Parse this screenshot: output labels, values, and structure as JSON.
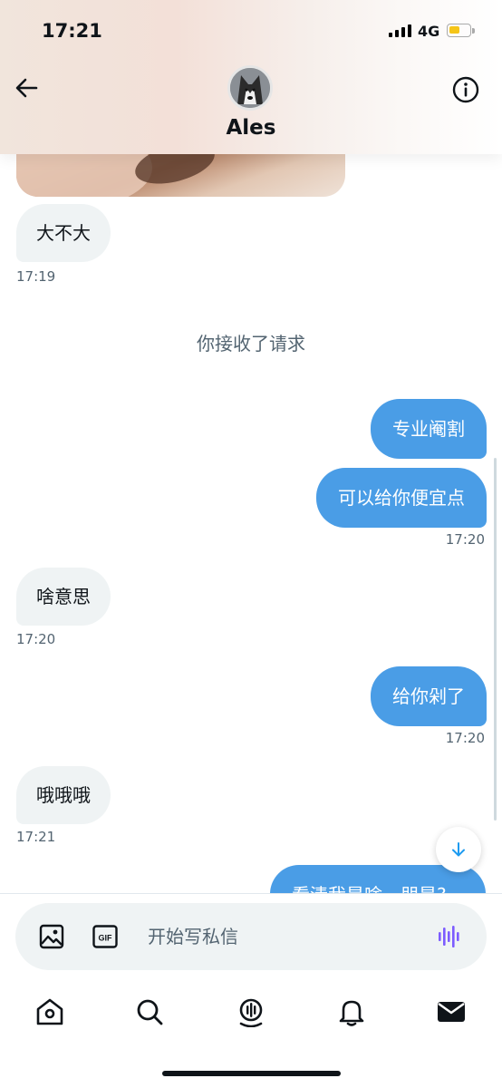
{
  "status_bar": {
    "time": "17:21",
    "network": "4G"
  },
  "header": {
    "contact_name": "Ales",
    "back_icon": "arrow-left-icon",
    "info_icon": "info-icon"
  },
  "messages": [
    {
      "direction": "in",
      "text": "大不大",
      "time": "17:19"
    },
    {
      "direction": "system",
      "text": "你接收了请求"
    },
    {
      "direction": "out",
      "text": "专业阉割"
    },
    {
      "direction": "out",
      "text": "可以给你便宜点",
      "time": "17:20"
    },
    {
      "direction": "in",
      "text": "啥意思",
      "time": "17:20"
    },
    {
      "direction": "out",
      "text": "给你剁了",
      "time": "17:20"
    },
    {
      "direction": "in",
      "text": "哦哦哦",
      "time": "17:21"
    },
    {
      "direction": "out",
      "text": "看清我是啥，朋是?"
    }
  ],
  "composer": {
    "placeholder": "开始写私信",
    "gif_label": "GIF"
  },
  "nav": {
    "items": [
      "home-icon",
      "search-icon",
      "spaces-icon",
      "notifications-icon",
      "messages-icon"
    ],
    "active": "messages-icon"
  },
  "colors": {
    "outgoing_bubble": "#4a9de6",
    "incoming_bubble": "#eff3f4",
    "accent_voice": "#7c5cff"
  }
}
